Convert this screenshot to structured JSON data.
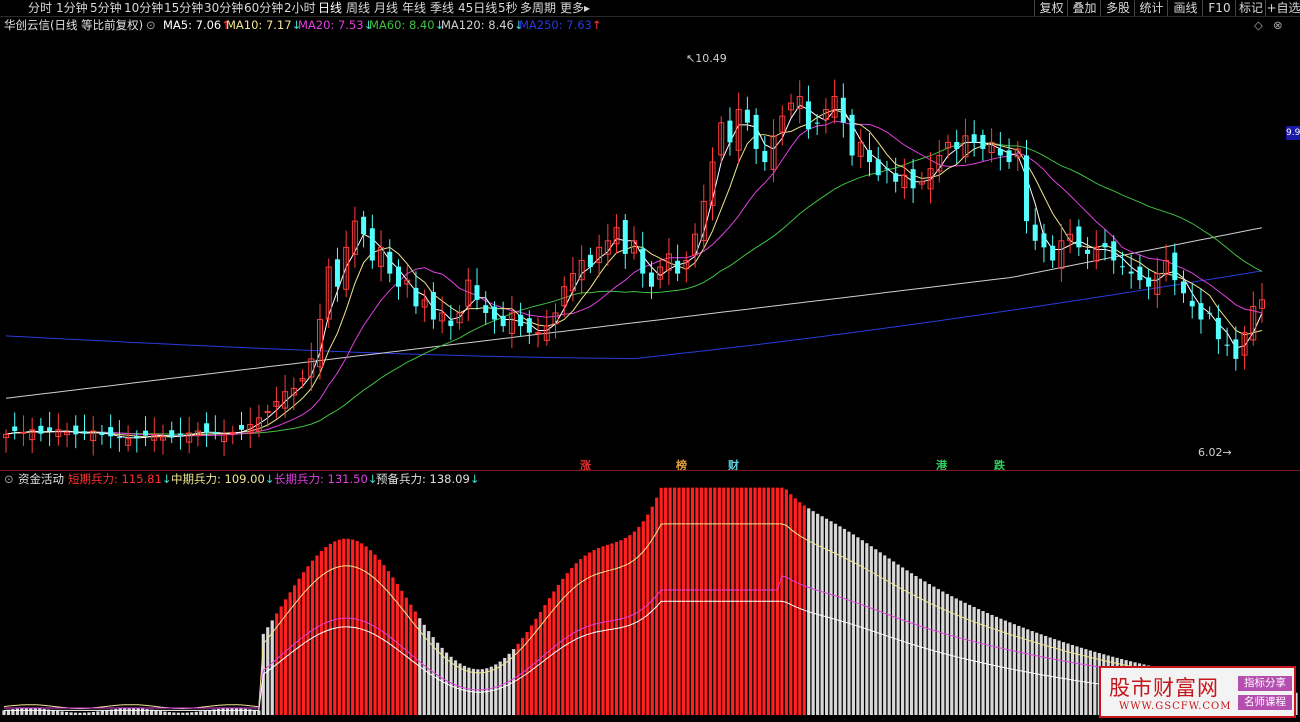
{
  "toolbar": {
    "periods": [
      "分时",
      "1分钟",
      "5分钟",
      "10分钟",
      "15分钟",
      "30分钟",
      "60分钟",
      "2小时",
      "日线",
      "周线",
      "月线",
      "年线",
      "季线",
      "45日线",
      "5秒",
      "多周期",
      "更多▸"
    ],
    "active_period": "日线",
    "right_buttons": [
      "复权",
      "叠加",
      "多股",
      "统计",
      "画线",
      "F10",
      "标记",
      "+自选"
    ]
  },
  "info": {
    "stock_name": "华创云信(日线 等比前复权)",
    "ma": [
      {
        "label": "MA5: 7.06",
        "arrow": "↑",
        "color": "#ffffff",
        "arrow_color": "#ff4040"
      },
      {
        "label": "MA10: 7.17",
        "arrow": "↓",
        "color": "#f0e68c",
        "arrow_color": "#40e0d0"
      },
      {
        "label": "MA20: 7.53",
        "arrow": "↓",
        "color": "#e040e0",
        "arrow_color": "#40e0d0"
      },
      {
        "label": "MA60: 8.40",
        "arrow": "↓",
        "color": "#40c040",
        "arrow_color": "#40e0d0"
      },
      {
        "label": "MA120: 8.46",
        "arrow": "↓",
        "color": "#d0d0d0",
        "arrow_color": "#40e0d0"
      },
      {
        "label": "MA250: 7.63",
        "arrow": "↑",
        "color": "#2a3adc",
        "arrow_color": "#ff4040"
      }
    ]
  },
  "price_labels": {
    "high": "10.49",
    "low": "6.02",
    "right_edge": "9.9"
  },
  "markers": [
    {
      "text": "涨",
      "color": "#e03030"
    },
    {
      "text": "榜",
      "color": "#e0a040"
    },
    {
      "text": "财",
      "color": "#60d0e0"
    },
    {
      "text": "港",
      "color": "#30d060"
    },
    {
      "text": "跌",
      "color": "#30d060"
    }
  ],
  "sub_indicator": {
    "name": "资金活动",
    "items": [
      {
        "label": "短期兵力: 115.81",
        "arrow": "↓",
        "color": "#ff3030"
      },
      {
        "label": "中期兵力: 109.00",
        "arrow": "↓",
        "color": "#f0e68c"
      },
      {
        "label": "长期兵力: 131.50",
        "arrow": "↓",
        "color": "#e040e0"
      },
      {
        "label": "预备兵力: 138.09",
        "arrow": "↓",
        "color": "#e0e0e0"
      }
    ]
  },
  "watermark": {
    "title": "股市财富网",
    "url": "WWW.GSCFW.COM",
    "tag1": "指标分享",
    "tag2": "名师课程"
  },
  "colors": {
    "up": "#ff3c3c",
    "down": "#54ffff",
    "bg": "#000000"
  },
  "chart_data": {
    "type": "candlestick",
    "high_label": 10.49,
    "low_label": 6.02,
    "close_series": [
      5.05,
      5.1,
      5.08,
      5.12,
      5.06,
      5.1,
      5.12,
      5.08,
      5.05,
      5.07,
      5.1,
      5.04,
      5.02,
      5.0,
      4.98,
      5.0,
      5.03,
      5.05,
      5.02,
      5.0,
      5.04,
      5.07,
      5.1,
      5.08,
      5.06,
      5.05,
      5.08,
      5.12,
      5.2,
      5.3,
      5.4,
      5.55,
      5.7,
      5.75,
      5.9,
      6.2,
      6.8,
      7.6,
      7.3,
      7.9,
      8.3,
      8.1,
      7.7,
      7.9,
      7.5,
      7.3,
      7.4,
      7.0,
      7.1,
      6.8,
      6.9,
      6.7,
      6.9,
      7.4,
      7.1,
      6.9,
      6.8,
      6.7,
      6.9,
      6.7,
      6.6,
      6.6,
      6.7,
      6.9,
      7.3,
      7.5,
      7.7,
      7.6,
      7.9,
      8.0,
      8.2,
      7.8,
      8.0,
      7.5,
      7.3,
      7.6,
      7.8,
      7.5,
      7.7,
      8.1,
      8.6,
      9.2,
      9.8,
      9.5,
      10.0,
      9.8,
      9.4,
      9.2,
      9.6,
      9.9,
      10.1,
      10.2,
      9.7,
      9.8,
      10.0,
      10.2,
      9.8,
      9.3,
      9.5,
      9.2,
      9.0,
      9.1,
      8.9,
      9.0,
      8.8,
      8.9,
      9.1,
      9.3,
      9.5,
      9.4,
      9.6,
      9.5,
      9.4,
      9.5,
      9.3,
      9.2,
      9.4,
      8.3,
      8.0,
      7.9,
      7.7,
      8.0,
      8.1,
      7.9,
      7.8,
      7.9,
      7.9,
      7.7,
      7.6,
      7.5,
      7.4,
      7.3,
      7.5,
      7.7,
      7.4,
      7.2,
      7.0,
      6.8,
      6.9,
      6.5,
      6.4,
      6.2,
      6.6,
      7.0,
      7.1
    ]
  }
}
